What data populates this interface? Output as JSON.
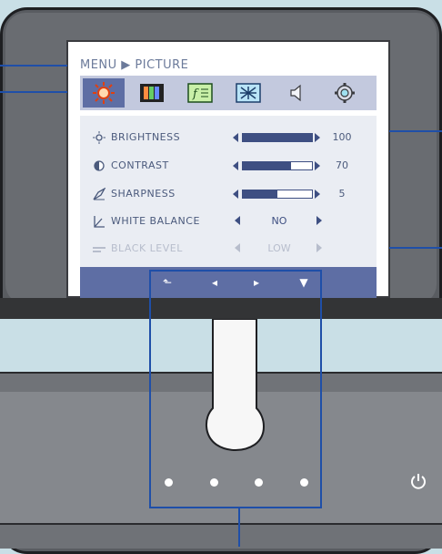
{
  "menu": {
    "path": "MENU ▶ PICTURE",
    "tabs": [
      {
        "icon": "sun-picture-icon",
        "active": true
      },
      {
        "icon": "color-bars-icon",
        "active": false
      },
      {
        "icon": "tracking-icon",
        "active": false
      },
      {
        "icon": "setup-grid-icon",
        "active": false
      },
      {
        "icon": "speaker-icon",
        "active": false
      },
      {
        "icon": "settings-gear-icon",
        "active": false
      }
    ],
    "items": [
      {
        "label": "BRIGHTNESS",
        "icon": "sun-icon",
        "value": "100",
        "level": 1.0
      },
      {
        "label": "CONTRAST",
        "icon": "half-circle-icon",
        "value": "70",
        "level": 0.7
      },
      {
        "label": "SHARPNESS",
        "icon": "sharpness-icon",
        "value": "5",
        "level": 0.5
      },
      {
        "label": "WHITE BALANCE",
        "icon": "white-balance-icon",
        "value": "NO"
      },
      {
        "label": "BLACK LEVEL",
        "icon": "black-level-icon",
        "value": "LOW",
        "disabled": true
      }
    ],
    "nav": {
      "back": "⬑",
      "left": "◂",
      "right": "▸",
      "down": "▼"
    }
  },
  "colors": {
    "accent": "#5e6ea4",
    "callout": "#1f4fa8",
    "panel": "#eaedf3"
  }
}
